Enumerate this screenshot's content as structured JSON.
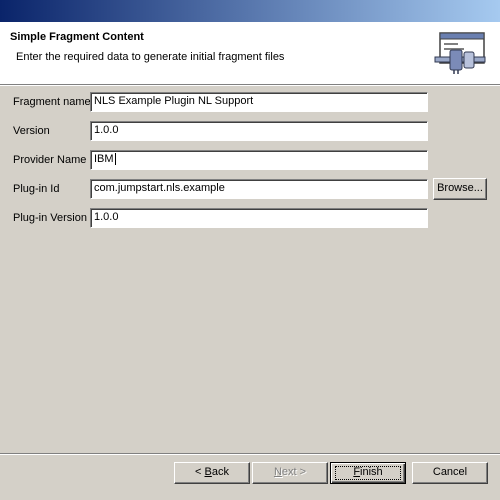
{
  "header": {
    "title": "Simple Fragment Content",
    "description": "Enter the required data to generate initial fragment files"
  },
  "form": {
    "fragment_name": {
      "label": "Fragment name",
      "value": "NLS Example Plugin NL Support"
    },
    "version": {
      "label": "Version",
      "value": "1.0.0"
    },
    "provider_name": {
      "label": "Provider Name",
      "value": "IBM"
    },
    "plugin_id": {
      "label": "Plug-in Id",
      "value": "com.jumpstart.nls.example"
    },
    "plugin_version": {
      "label": "Plug-in Version",
      "value": "1.0.0"
    }
  },
  "buttons": {
    "browse": "Browse...",
    "back_mnemonic": "B",
    "back_rest": "ack",
    "next_mnemonic": "N",
    "next_rest": "ext",
    "finish_mnemonic": "F",
    "finish_rest": "inish",
    "cancel": "Cancel"
  },
  "icons": {
    "wizard_banner": "plugin-fragment-wizard-icon"
  },
  "colors": {
    "titlebar_start": "#0a246a",
    "titlebar_end": "#a6caf0",
    "dialog_background": "#d4d0c8"
  }
}
